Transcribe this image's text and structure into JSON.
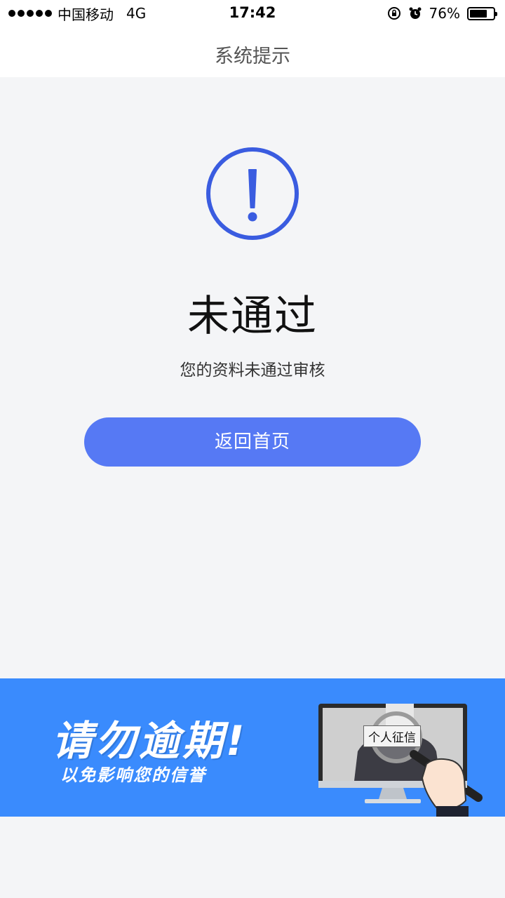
{
  "status_bar": {
    "carrier": "中国移动",
    "network": "4G",
    "time": "17:42",
    "battery": "76%",
    "battery_level": 0.76
  },
  "nav": {
    "title": "系统提示"
  },
  "result": {
    "icon": "exclamation-circle-icon",
    "title": "未通过",
    "description": "您的资料未通过审核",
    "accent_color": "#3a5ce0"
  },
  "actions": {
    "home_button_label": "返回首页",
    "button_color": "#5679f4"
  },
  "banner": {
    "headline": "请勿逾期!",
    "subline": "以免影响您的信誉",
    "monitor_label": "个人征信",
    "background_color": "#3a8bfd"
  }
}
